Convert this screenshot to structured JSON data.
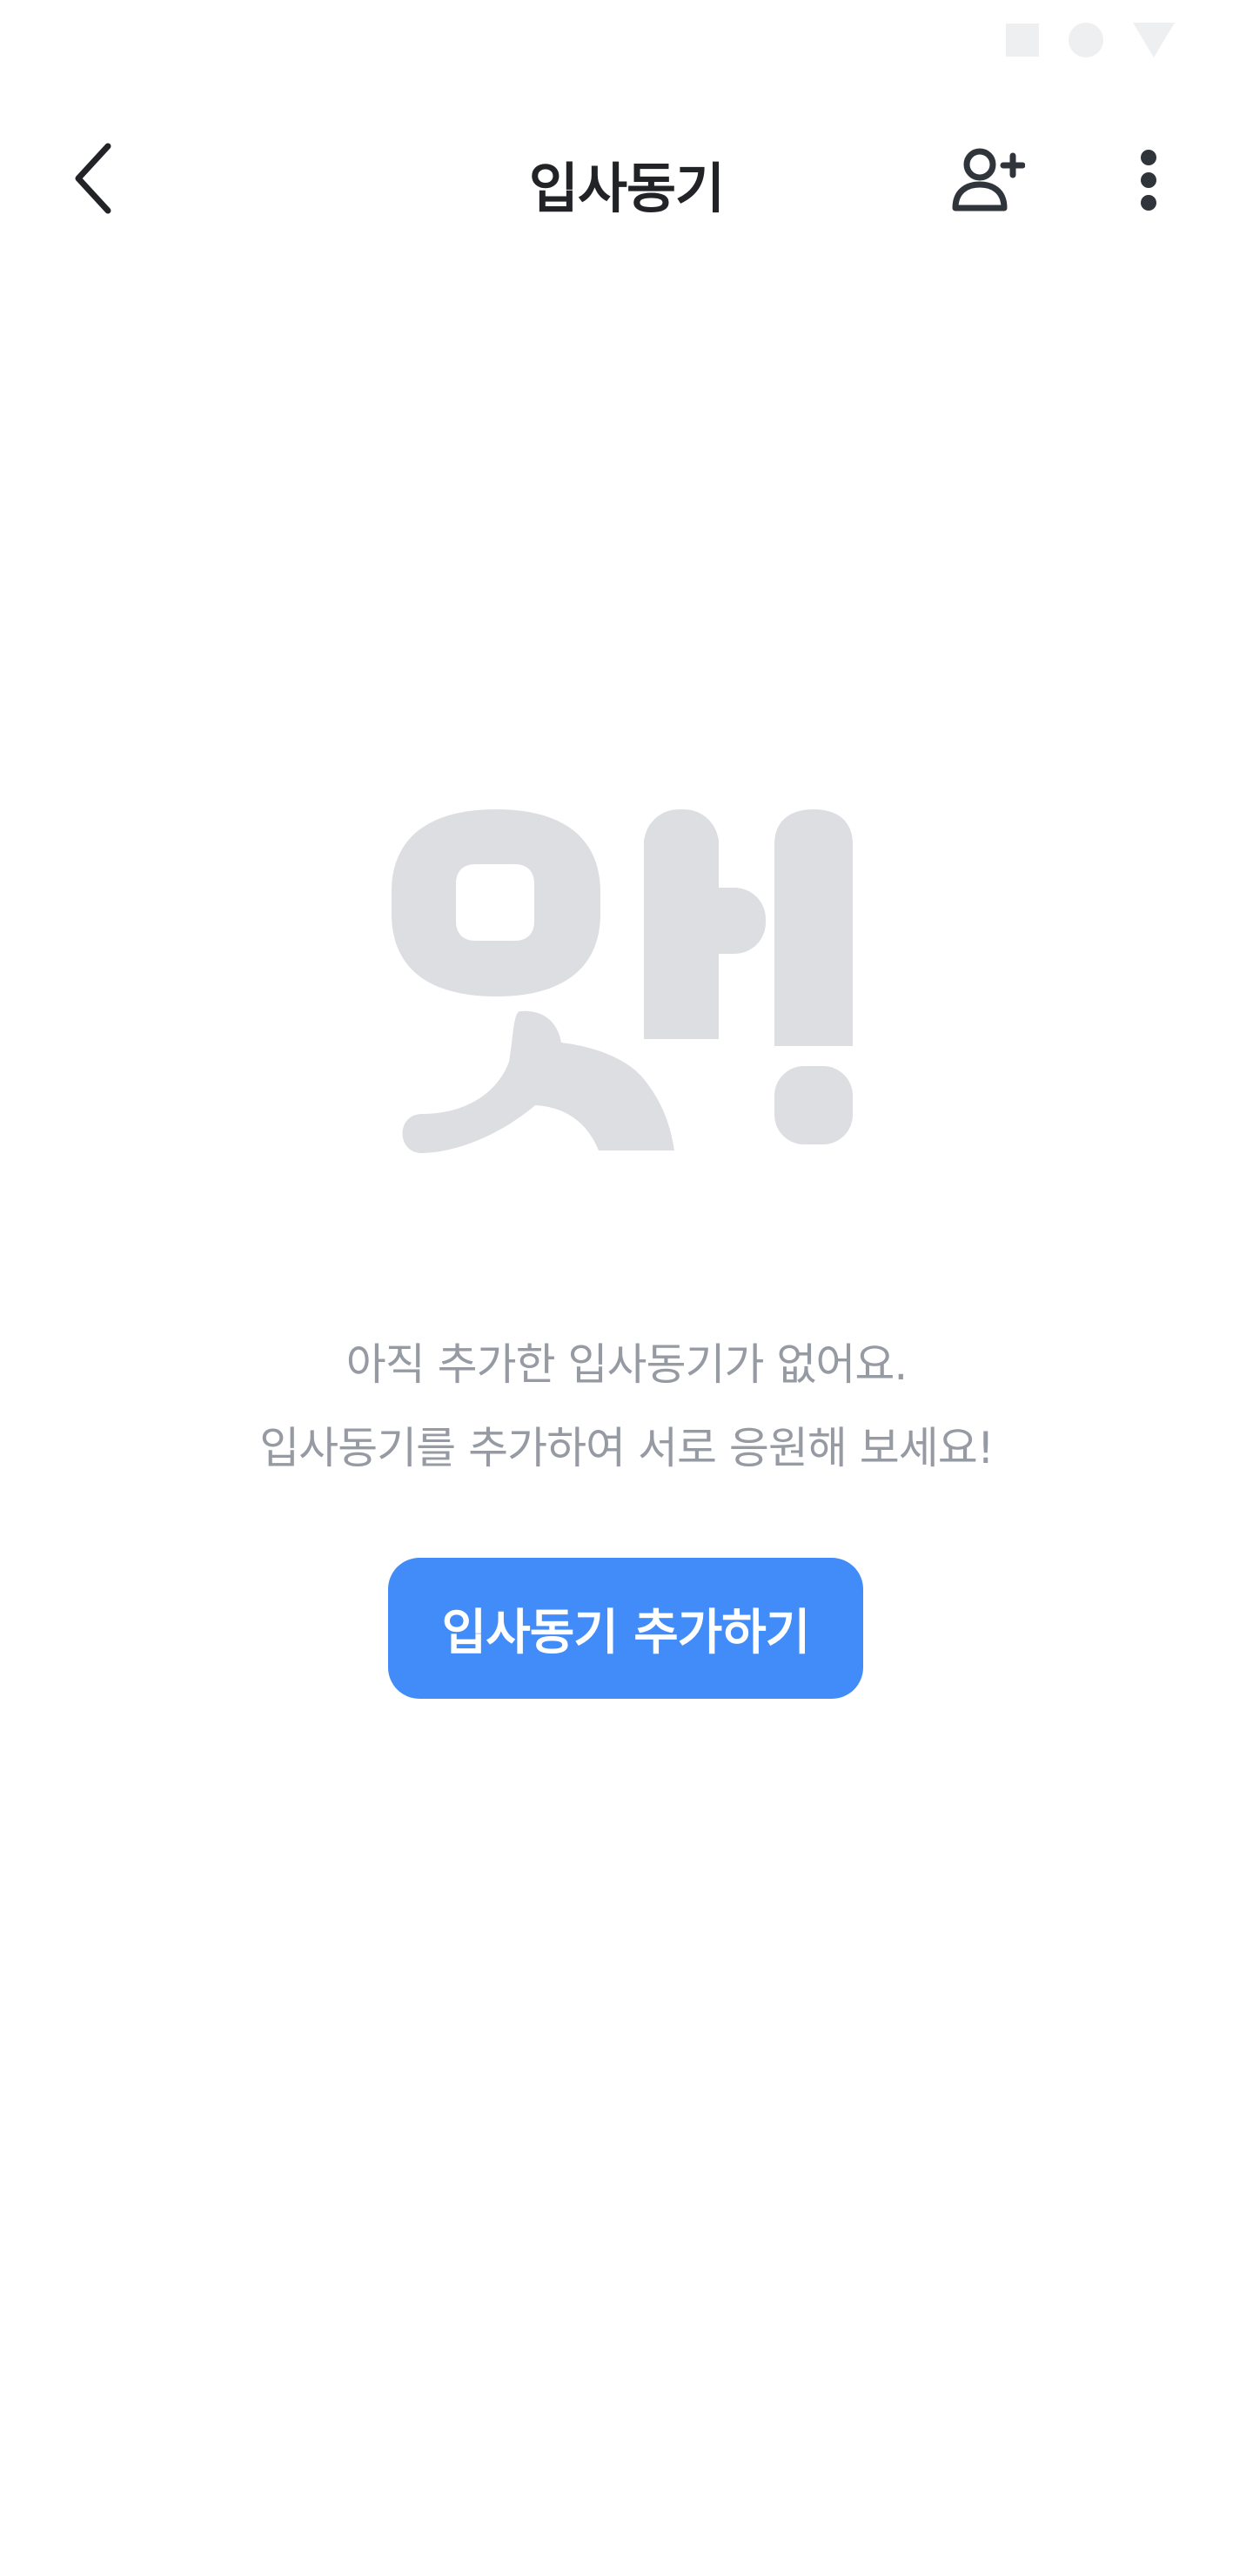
{
  "status_bar": {
    "icons": [
      "square-icon",
      "circle-icon",
      "triangle-icon"
    ]
  },
  "header": {
    "title": "입사동기",
    "back_icon": "chevron-left-icon",
    "add_friend_icon": "person-add-icon",
    "more_icon": "more-vertical-icon"
  },
  "empty_state": {
    "illustration_text": "앗!",
    "line1": "아직 추가한 입사동기가 없어요.",
    "line2": "입사동기를 추가하여 서로 응원해 보세요!",
    "button_label": "입사동기 추가하기"
  },
  "colors": {
    "accent": "#418cf8",
    "title": "#222326",
    "muted_text": "#959aa3",
    "illustration": "#dcdee1"
  }
}
